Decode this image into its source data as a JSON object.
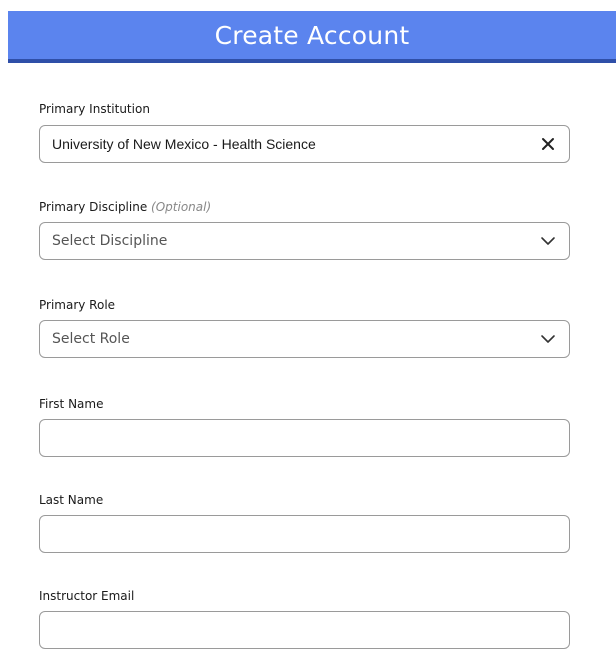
{
  "header": {
    "title": "Create Account"
  },
  "form": {
    "institution": {
      "label": "Primary Institution",
      "value": "University of New Mexico - Health Science",
      "clear_icon": "close-icon"
    },
    "discipline": {
      "label": "Primary Discipline",
      "optional_text": "(Optional)",
      "placeholder": "Select Discipline",
      "icon": "chevron-down-icon"
    },
    "role": {
      "label": "Primary Role",
      "placeholder": "Select Role",
      "icon": "chevron-down-icon"
    },
    "first_name": {
      "label": "First Name",
      "value": ""
    },
    "last_name": {
      "label": "Last Name",
      "value": ""
    },
    "instructor_email": {
      "label": "Instructor Email",
      "value": ""
    }
  },
  "colors": {
    "header_bg": "#5b84ee",
    "header_border": "#2f4fa8",
    "input_border": "#9a9a9a"
  }
}
